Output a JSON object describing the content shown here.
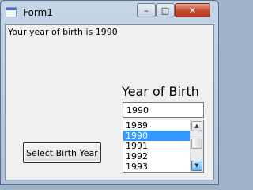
{
  "window": {
    "title": "Form1",
    "controls": {
      "minimize": "–",
      "maximize": "□",
      "close": "✕"
    }
  },
  "output_label": "Your year of birth is 1990",
  "year_of_birth_label": "Year of Birth",
  "year_input": {
    "value": "1990"
  },
  "year_list": {
    "items": [
      "1989",
      "1990",
      "1991",
      "1992",
      "1993"
    ],
    "selected": "1990",
    "scroll": {
      "up_icon": "▲",
      "down_icon": "▼"
    }
  },
  "select_button_label": "Select Birth Year",
  "colors": {
    "selection": "#3399ff",
    "close_button": "#c44a2f"
  }
}
